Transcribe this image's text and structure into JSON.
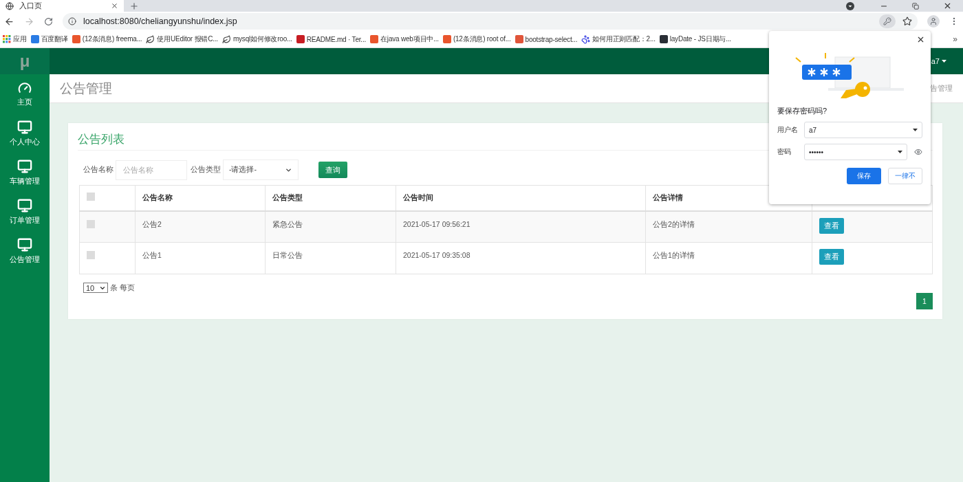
{
  "browser": {
    "tab": {
      "title": "入口页",
      "selected": true
    },
    "url": "localhost:8080/cheliangyunshu/index.jsp",
    "back_disabled": false,
    "forward_disabled": true,
    "bookmarks": [
      {
        "label": "应用",
        "kind": "apps"
      },
      {
        "label": "百度翻译",
        "kind": "translate"
      },
      {
        "label": "(12条消息) freema...",
        "kind": "csdn"
      },
      {
        "label": "使用UEditor 报错C...",
        "kind": "leaf"
      },
      {
        "label": "mysql如何修改roo...",
        "kind": "leaf"
      },
      {
        "label": "README.md · Ter...",
        "kind": "gitee"
      },
      {
        "label": "在java web项目中...",
        "kind": "csdn"
      },
      {
        "label": "(12条消息) root of...",
        "kind": "csdn"
      },
      {
        "label": "bootstrap-select...",
        "kind": "jian"
      },
      {
        "label": "如何用正则匹配：2...",
        "kind": "paw"
      },
      {
        "label": "layDate - JS日期与...",
        "kind": "lay"
      }
    ],
    "more": "»"
  },
  "app": {
    "logo": "μ",
    "user": "a7",
    "sidebar": [
      {
        "label": "主页",
        "kind": "dashboard",
        "selected": false
      },
      {
        "label": "个人中心",
        "kind": "monitor",
        "selected": false
      },
      {
        "label": "车辆管理",
        "kind": "monitor",
        "selected": false
      },
      {
        "label": "订单管理",
        "kind": "monitor",
        "selected": false
      },
      {
        "label": "公告管理",
        "kind": "monitor",
        "selected": false
      }
    ],
    "page_title": "公告管理",
    "breadcrumb": "告管理",
    "card_title": "公告列表",
    "filters": {
      "name_label": "公告名称",
      "name_placeholder": "公告名称",
      "type_label": "公告类型",
      "type_value": "-请选择-",
      "search_button": "查询"
    },
    "table": {
      "select_all_checked": false,
      "columns": [
        "公告名称",
        "公告类型",
        "公告时间",
        "公告详情"
      ],
      "rows": [
        {
          "checked": false,
          "cells": [
            "公告2",
            "紧急公告",
            "2021-05-17 09:56:21",
            "公告2的详情"
          ],
          "action": "查看"
        },
        {
          "checked": false,
          "cells": [
            "公告1",
            "日常公告",
            "2021-05-17 09:35:08",
            "公告1的详情"
          ],
          "action": "查看"
        }
      ]
    },
    "page_size": "10",
    "page_size_label": "条 每页",
    "pages": [
      {
        "label": "1",
        "selected": true
      }
    ]
  },
  "password_dialog": {
    "question": "要保存密码吗?",
    "username_label": "用户名",
    "username": "a7",
    "password_label": "密码",
    "password": "••••••",
    "save": "保存",
    "never": "一律不"
  }
}
